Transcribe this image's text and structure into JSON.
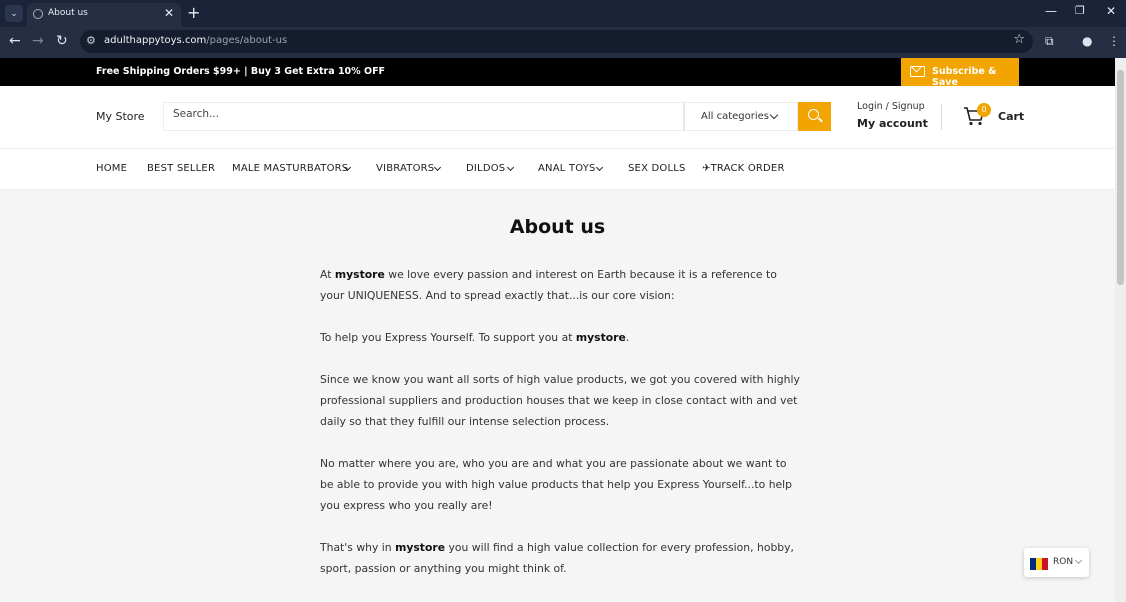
{
  "browser": {
    "tab_title": "About us",
    "url_domain": "adulthappytoys.com",
    "url_path": "/pages/about-us",
    "tab_close_glyph": "✕",
    "new_tab_glyph": "+",
    "icons": [
      "tab-list-icon",
      "back-icon",
      "forward-icon",
      "reload-icon",
      "site-info-icon",
      "bookmark-star-icon",
      "extensions-icon",
      "profile-icon",
      "menu-icon",
      "minimize-icon",
      "restore-icon",
      "close-window-icon"
    ]
  },
  "announcement": {
    "text": "Free Shipping Orders $99+ | Buy 3 Get Extra 10% OFF",
    "subscribe_label": "Subscribe & Save"
  },
  "header": {
    "logo": "My Store",
    "search_placeholder": "Search...",
    "categories_label": "All categories",
    "login_label": "Login / Signup",
    "account_label": "My account",
    "cart_count": "0",
    "cart_label": "Cart"
  },
  "nav": {
    "items": [
      {
        "label": "HOME"
      },
      {
        "label": "BEST SELLER"
      },
      {
        "label": "MALE MASTURBATORS"
      },
      {
        "label": "VIBRATORS"
      },
      {
        "label": "DILDOS"
      },
      {
        "label": "ANAL TOYS"
      },
      {
        "label": "SEX DOLLS"
      },
      {
        "label": "✈TRACK ORDER"
      }
    ]
  },
  "content": {
    "title": "About us",
    "p1_pre": "At ",
    "p1_bold": "mystore",
    "p1_post": " we love every passion and interest on Earth because it is a reference to your UNIQUENESS. And to spread exactly that...is our core vision:",
    "p2_pre": "To help you Express Yourself. To support you at ",
    "p2_bold": "mystore",
    "p2_post": ".",
    "p3": "Since we know you want all sorts of high value products, we got you covered with highly professional suppliers and production houses that we keep in close contact with and vet daily so that they fulfill our intense selection process.",
    "p4": "No matter where you are, who you are and what you are passionate about we want to be able to provide you with high value products that help you Express Yourself...to help you express who you really are!",
    "p5_pre": "That's why in ",
    "p5_bold": "mystore",
    "p5_post": " you will find a high value collection for every profession, hobby, sport, passion or anything you might think of."
  },
  "currency": {
    "code": "RON",
    "flag_colors": [
      "#002b7f",
      "#fcd116",
      "#ce1126"
    ]
  },
  "colors": {
    "accent": "#f2a400",
    "announcement_bg": "#000000",
    "browser_bg": "#1b2338"
  }
}
